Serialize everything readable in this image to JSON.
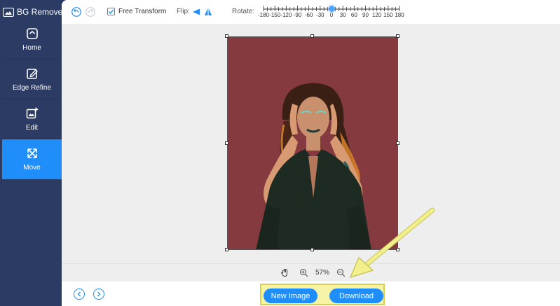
{
  "app": {
    "title": "BG Remover"
  },
  "sidebar": {
    "items": [
      {
        "label": "Home",
        "icon": "home-icon",
        "active": false
      },
      {
        "label": "Edge Refine",
        "icon": "edit-pencil-icon",
        "active": false
      },
      {
        "label": "Edit",
        "icon": "image-add-icon",
        "active": false
      },
      {
        "label": "Move",
        "icon": "move-arrows-icon",
        "active": true
      }
    ]
  },
  "toolbar": {
    "undo_icon": "undo-icon",
    "redo_icon": "redo-icon",
    "free_transform_label": "Free Transform",
    "free_transform_checked": true,
    "flip_label": "Flip:",
    "rotate_label": "Rotate:",
    "rotate_ticks": [
      "-180",
      "-150",
      "-120",
      "-90",
      "-60",
      "-30",
      "0",
      "30",
      "60",
      "90",
      "120",
      "150",
      "180"
    ],
    "rotate_value": 0
  },
  "zoom": {
    "value": "57%"
  },
  "actions": {
    "new_image": "New Image",
    "download": "Download"
  },
  "colors": {
    "accent": "#1f8efa",
    "sidebar": "#2c3b64",
    "photo_background": "#843a3e",
    "highlight_box": "#f7f3a6",
    "arrow": "#f2f08c"
  }
}
